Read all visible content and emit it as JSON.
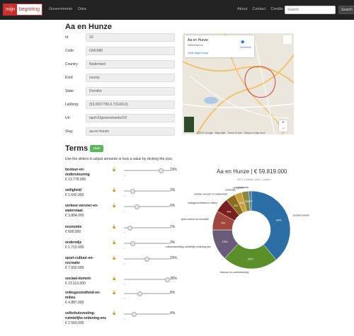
{
  "navbar": {
    "logo_part1": "mijn",
    "logo_part2": "begroting",
    "left_links": [
      "Governments",
      "Data"
    ],
    "right_links": [
      "About",
      "Contact",
      "Credits"
    ],
    "search_placeholder": "Search",
    "search_button": "Search"
  },
  "page_title": "Aa en Hunze",
  "fields": [
    {
      "label": "Id:",
      "value": "10"
    },
    {
      "label": "Code:",
      "value": "GM1680"
    },
    {
      "label": "Country:",
      "value": "Nederland"
    },
    {
      "label": "Kind:",
      "value": "county"
    },
    {
      "label": "State:",
      "value": "Drenthe"
    },
    {
      "label": "Lat/long:",
      "value": "(53.0007799,6.7214013)"
    },
    {
      "label": "Uri:",
      "value": "/api/v1/governments/10/"
    },
    {
      "label": "Slug:",
      "value": "aa-en-hunze"
    }
  ],
  "map": {
    "card_title": "Aa en Hunze",
    "card_sub": "Netherlands",
    "card_link": "View larger map",
    "directions": "Directions",
    "footer": "©2017 Google · Map data · Terms of Use · Report a map error",
    "google": "Google",
    "icon": "location-pin-icon"
  },
  "terms": {
    "title": "Terms",
    "hide_label": "Hide",
    "instructions": "Use the sliders to adjust amounts or lock a value by clicking the icon.",
    "tick_min": "0",
    "items": [
      {
        "name": "bestuur-en-ondersteuning",
        "amount": "€ 13.778.000",
        "pct": "23%",
        "value": 23
      },
      {
        "name": "veiligheid",
        "amount": "€ 1.642.000",
        "pct": "3%",
        "value": 3
      },
      {
        "name": "verkeer-vervoer-en-waterstaat",
        "amount": "€ 3.804.000",
        "pct": "6%",
        "value": 6
      },
      {
        "name": "economie",
        "amount": "€ 680.000",
        "pct": "1%",
        "value": 1
      },
      {
        "name": "onderwijs",
        "amount": "€ 1.715.000",
        "pct": "3%",
        "value": 3
      },
      {
        "name": "sport-cultuur-en-recreatie",
        "amount": "€ 7.650.000",
        "pct": "13%",
        "value": 13
      },
      {
        "name": "sociaal-domein",
        "amount": "€ 23.113.000",
        "pct": "39%",
        "value": 39
      },
      {
        "name": "volksgezondheid-en-milieu",
        "amount": "€ 4.887.000",
        "pct": "8%",
        "value": 8
      },
      {
        "name": "volkshuisvesting-ruimtelijke-ordening-enz",
        "amount": "€ 2.550.000",
        "pct": "4%",
        "value": 4
      }
    ]
  },
  "chart_data": {
    "type": "pie",
    "title": "Aa en Hunze | € 59.819.000",
    "subtitle": "2017 | Whole year | Lasten",
    "slices": [
      {
        "name": "sociaal-domein",
        "value": 39,
        "label": "39%",
        "color": "#2b6fa6"
      },
      {
        "name": "bestuur-en-ondersteuning",
        "value": 23,
        "label": "23%",
        "color": "#5a8f2a"
      },
      {
        "name": "volkshuisvesting-ruimtelijke-ordening-enz",
        "value": 13,
        "label": "13%",
        "color": "#6b5b7b"
      },
      {
        "name": "sport-cultuur-en-recreatie",
        "value": 8,
        "label": "8%",
        "color": "#a0463a"
      },
      {
        "name": "volksgezondheid-en-milieu",
        "value": 6,
        "label": "6%",
        "color": "#7a1f1f"
      },
      {
        "name": "verkeer-vervoer-en-waterstaat",
        "value": 4,
        "label": "4%",
        "color": "#8c6d1f"
      },
      {
        "name": "onderwijs",
        "value": 3,
        "label": "3%",
        "color": "#c9a03a"
      },
      {
        "name": "veiligheid",
        "value": 3,
        "label": "3%",
        "color": "#8a8a3a"
      },
      {
        "name": "economie",
        "value": 1,
        "label": "1%",
        "color": "#3a7aa0"
      }
    ]
  }
}
